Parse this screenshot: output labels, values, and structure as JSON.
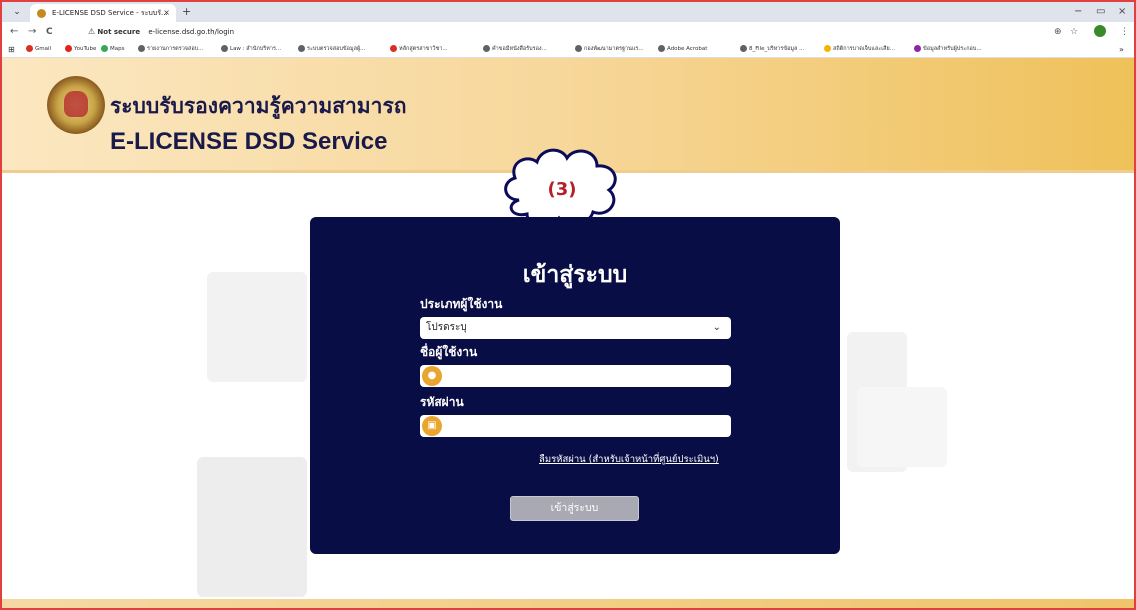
{
  "browser": {
    "tab_title": "E-LICENSE DSD Service - ระบบรั...",
    "tab_close": "×",
    "new_tab": "+",
    "tab_menu": "⌄",
    "window_controls": {
      "minimize": "−",
      "restore": "▭",
      "close": "×"
    },
    "nav": {
      "back": "←",
      "forward": "→",
      "reload": "C"
    },
    "security_icon": "⚠",
    "security_label": "Not secure",
    "url": "e-license.dsd.go.th/login",
    "zoom_icon": "⊕",
    "star_icon": "☆",
    "menu_icon": "⋮",
    "apps_icon": "⊞"
  },
  "bookmarks": [
    {
      "label": "Gmail",
      "color": "#d93025"
    },
    {
      "label": "YouTube",
      "color": "#e62117"
    },
    {
      "label": "Maps",
      "color": "#34a853"
    },
    {
      "label": "รายงานการตรวจสอบ...",
      "color": "#5f6368"
    },
    {
      "label": "Law : สำนักบริหาร...",
      "color": "#5f6368"
    },
    {
      "label": "ระบบตรวจสอบข้อมูลผู้...",
      "color": "#5f6368"
    },
    {
      "label": "หลักสูตรสาขาวิชา...",
      "color": "#d93025"
    },
    {
      "label": "คำขอมีหนังสือรับรอง...",
      "color": "#5f6368"
    },
    {
      "label": "กองพัฒนามาตรฐานแร...",
      "color": "#5f6368"
    },
    {
      "label": "Adobe Acrobat",
      "color": "#5f6368"
    },
    {
      "label": "8_File_บริหารข้อมูล ...",
      "color": "#5f6368"
    },
    {
      "label": "สถิติการบาดเจ็บและเสีย...",
      "color": "#f4b400"
    },
    {
      "label": "ข้อมูลสำหรับผู้ประกอบ...",
      "color": "#8e24aa"
    }
  ],
  "bookmarks_more": "»",
  "site": {
    "title_th": "ระบบรับรองความรู้ความสามารถ",
    "title_en": "E-LICENSE DSD Service"
  },
  "annotation": {
    "label": "(3)"
  },
  "login": {
    "title": "เข้าสู่ระบบ",
    "user_type_label": "ประเภทผู้ใช้งาน",
    "user_type_value": "โปรดระบุ",
    "username_label": "ชื่อผู้ใช้งาน",
    "username_value": "",
    "password_label": "รหัสผ่าน",
    "password_value": "",
    "forgot_link": "ลืมรหัสผ่าน (สำหรับเจ้าหน้าที่ศูนย์ประเมินฯ)",
    "submit_label": "เข้าสู่ระบบ"
  }
}
